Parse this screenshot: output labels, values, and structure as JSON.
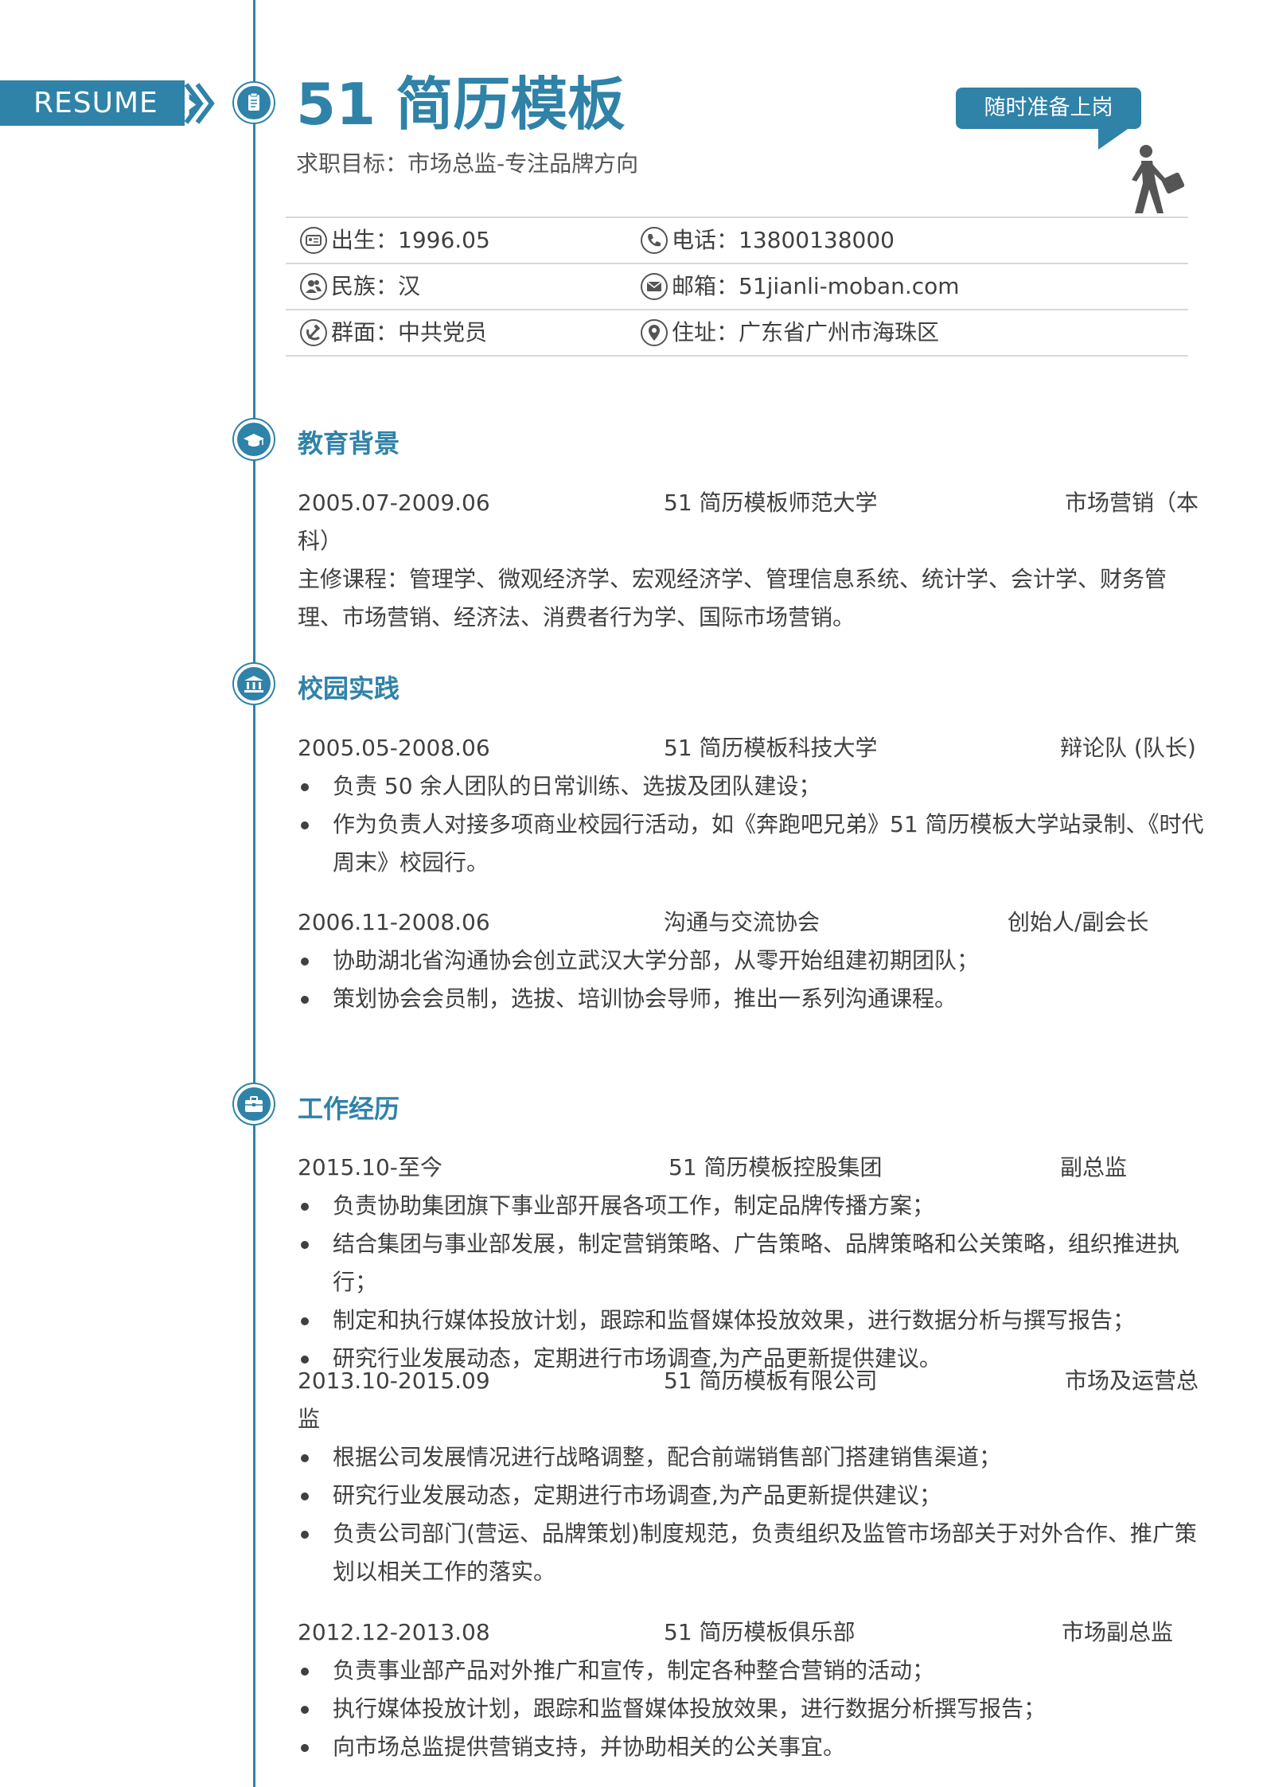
{
  "header": {
    "badge": "RESUME",
    "name": "51 简历模板",
    "objective": "求职目标：市场总监-专注品牌方向",
    "bubble": "随时准备上岗"
  },
  "info": {
    "birth": "出生：1996.05",
    "phone": "电话：13800138000",
    "ethnicity": "民族：汉",
    "email": "邮箱：51jianli-moban.com",
    "politics": "群面：中共党员",
    "address": "住址：广东省广州市海珠区"
  },
  "education": {
    "title": "教育背景",
    "period": "2005.07-2009.06",
    "school": "51 简历模板师范大学",
    "major_line1": "市场营销（本",
    "major_line2": "科）",
    "courses": "主修课程：管理学、微观经济学、宏观经济学、管理信息系统、统计学、会计学、财务管理、市场营销、经济法、消费者行为学、国际市场营销。"
  },
  "campus": {
    "title": "校园实践",
    "items": [
      {
        "period": "2005.05-2008.06",
        "org": "51 简历模板科技大学",
        "role": "辩论队 (队长)",
        "bullets": [
          "负责 50 余人团队的日常训练、选拔及团队建设；",
          "作为负责人对接多项商业校园行活动，如《奔跑吧兄弟》51 简历模板大学站录制、《时代周末》校园行。"
        ]
      },
      {
        "period": "2006.11-2008.06",
        "org": "沟通与交流协会",
        "role": "创始人/副会长",
        "bullets": [
          "协助湖北省沟通协会创立武汉大学分部，从零开始组建初期团队；",
          "策划协会会员制，选拔、培训协会导师，推出一系列沟通课程。"
        ]
      }
    ]
  },
  "work": {
    "title": "工作经历",
    "items": [
      {
        "period": "2015.10-至今",
        "org": "51 简历模板控股集团",
        "role": "副总监",
        "bullets": [
          "负责协助集团旗下事业部开展各项工作，制定品牌传播方案；",
          "结合集团与事业部发展，制定营销策略、广告策略、品牌策略和公关策略，组织推进执行；",
          "制定和执行媒体投放计划，跟踪和监督媒体投放效果，进行数据分析与撰写报告；",
          "研究行业发展动态，定期进行市场调查,为产品更新提供建议。"
        ]
      },
      {
        "period": "2013.10-2015.09",
        "org": "51 简历模板有限公司",
        "role_line1": "市场及运营总",
        "role_line2": "监",
        "bullets": [
          "根据公司发展情况进行战略调整，配合前端销售部门搭建销售渠道；",
          "研究行业发展动态，定期进行市场调查,为产品更新提供建议；",
          "负责公司部门(营运、品牌策划)制度规范，负责组织及监管市场部关于对外合作、推广策划以相关工作的落实。"
        ]
      },
      {
        "period": "2012.12-2013.08",
        "org": "51 简历模板俱乐部",
        "role": "市场副总监",
        "bullets": [
          "负责事业部产品对外推广和宣传，制定各种整合营销的活动；",
          "执行媒体投放计划，跟踪和监督媒体投放效果，进行数据分析撰写报告；",
          "向市场总监提供营销支持，并协助相关的公关事宜。"
        ]
      }
    ]
  },
  "colors": {
    "accent": "#2f82a8",
    "text": "#404040"
  }
}
